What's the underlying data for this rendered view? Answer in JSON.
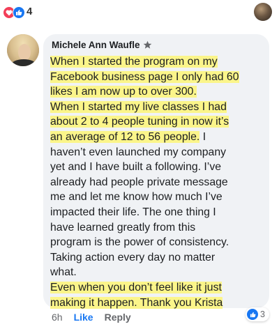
{
  "reactions": {
    "count": "4",
    "types": [
      "love-icon",
      "like-icon"
    ]
  },
  "comment": {
    "author": "Michele Ann Waufle",
    "lines": [
      "When I started the program on my",
      "Facebook business page I only had 60",
      "likes I am now up to over 300.",
      "When I started my live classes I had",
      "about 2 to 4 people tuning in now it’s",
      "an average of 12 to 56 people.",
      " I",
      "haven’t even launched my company",
      "yet and I have built a following. I’ve",
      "already had people private message",
      "me and let me know how much I’ve",
      "impacted their life. The one thing I",
      "have learned greatly from this",
      "program is the power of consistency.",
      "Taking action every day no matter",
      "what.",
      "Even when you don’t feel like it just",
      "making it happen. Thank you Krista"
    ],
    "highlight_color": "#fbf58a",
    "bubble_color": "#f0f2f5"
  },
  "actions": {
    "time": "6h",
    "like": "Like",
    "reply": "Reply",
    "like_count": "3"
  },
  "colors": {
    "brand": "#1877f2",
    "love": "#f33e58"
  }
}
